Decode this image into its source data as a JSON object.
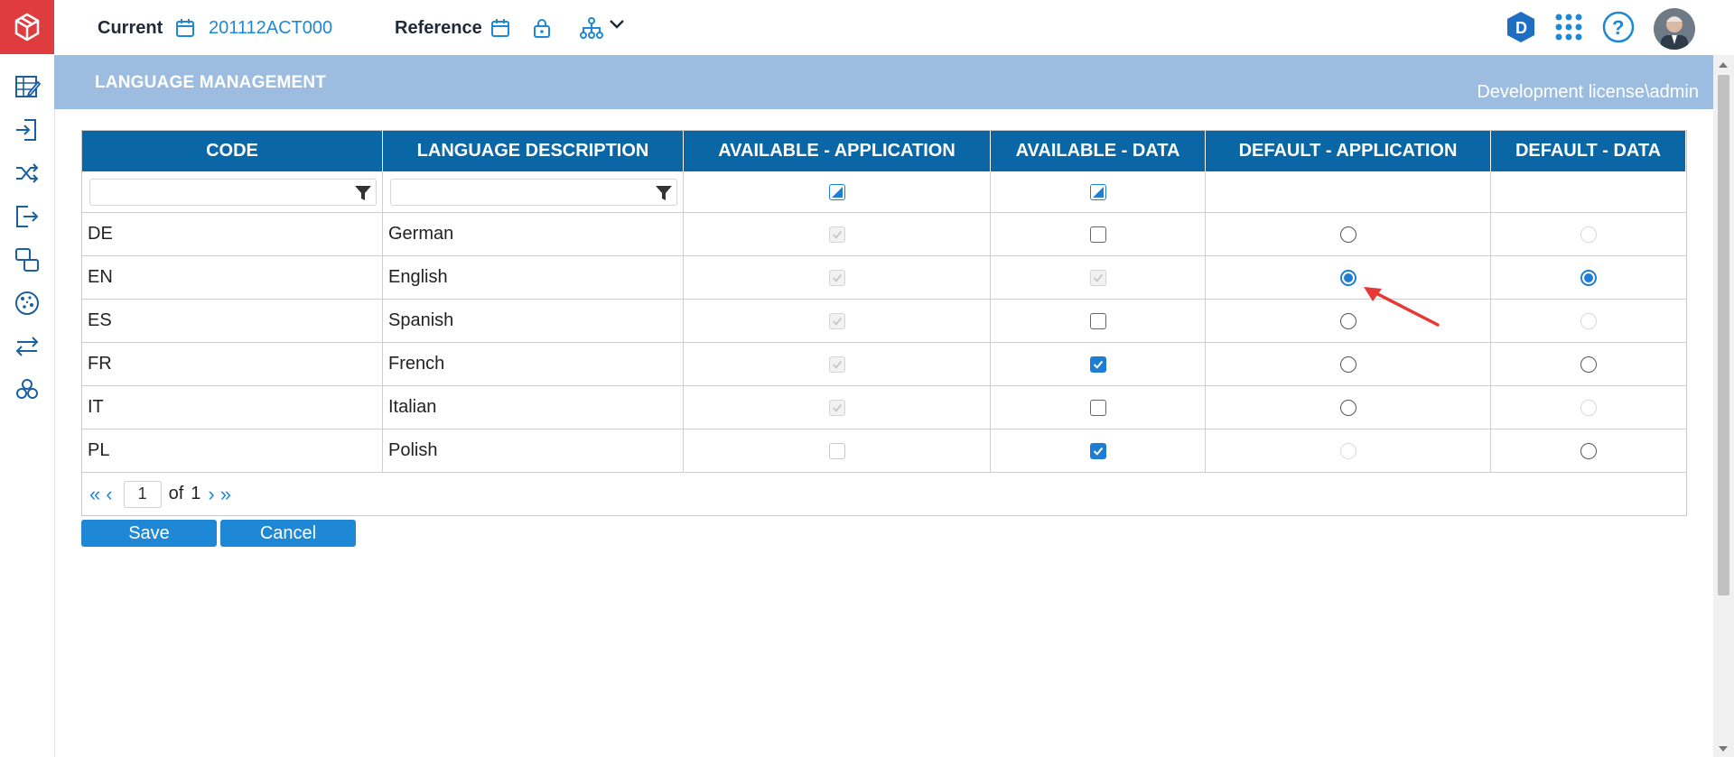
{
  "topbar": {
    "current_label": "Current",
    "current_value": "201112ACT000",
    "reference_label": "Reference"
  },
  "page": {
    "title": "LANGUAGE MANAGEMENT",
    "user": "Development license\\admin"
  },
  "grid": {
    "columns": [
      "CODE",
      "LANGUAGE DESCRIPTION",
      "AVAILABLE - APPLICATION",
      "AVAILABLE - DATA",
      "DEFAULT - APPLICATION",
      "DEFAULT - DATA"
    ],
    "rows": [
      {
        "code": "DE",
        "description": "German",
        "available_application": "checked-disabled",
        "available_data": "unchecked",
        "default_application": "unselected",
        "default_data": "disabled"
      },
      {
        "code": "EN",
        "description": "English",
        "available_application": "checked-disabled",
        "available_data": "checked-disabled",
        "default_application": "selected",
        "default_data": "selected"
      },
      {
        "code": "ES",
        "description": "Spanish",
        "available_application": "checked-disabled",
        "available_data": "unchecked",
        "default_application": "unselected",
        "default_data": "disabled"
      },
      {
        "code": "FR",
        "description": "French",
        "available_application": "checked-disabled",
        "available_data": "checked",
        "default_application": "unselected",
        "default_data": "unselected"
      },
      {
        "code": "IT",
        "description": "Italian",
        "available_application": "checked-disabled",
        "available_data": "unchecked",
        "default_application": "unselected",
        "default_data": "disabled"
      },
      {
        "code": "PL",
        "description": "Polish",
        "available_application": "unchecked-disabled",
        "available_data": "checked",
        "default_application": "disabled",
        "default_data": "unselected"
      }
    ]
  },
  "pager": {
    "current_page": "1",
    "of_label": "of",
    "total_pages": "1"
  },
  "buttons": {
    "save": "Save",
    "cancel": "Cancel"
  },
  "colors": {
    "brand_red": "#e03b3f",
    "header_blue": "#0b66a5",
    "title_band": "#9dbde0",
    "accent": "#1e88d6"
  }
}
